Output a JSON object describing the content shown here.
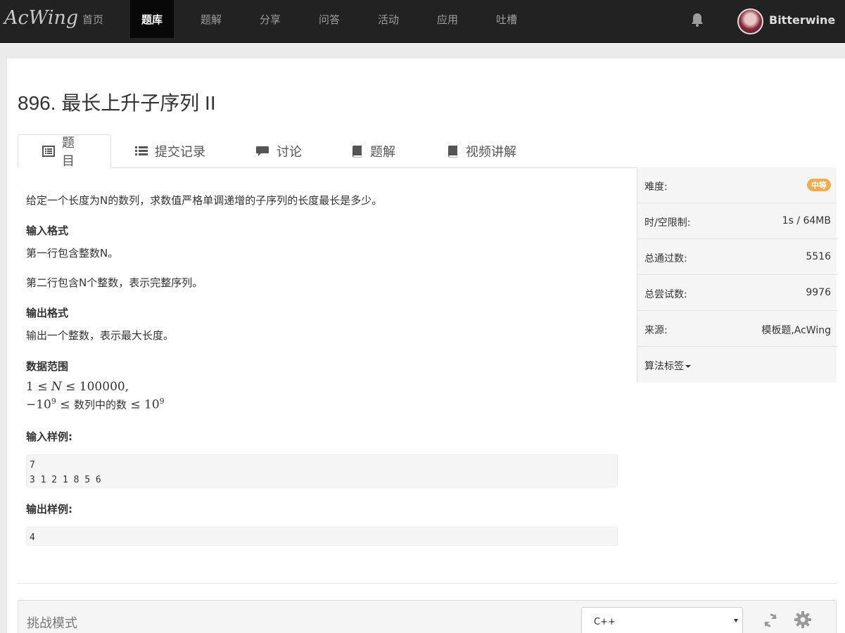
{
  "navbar": {
    "logo": "AcWing",
    "items": [
      "首页",
      "题库",
      "题解",
      "分享",
      "问答",
      "活动",
      "应用",
      "吐槽"
    ],
    "active_index": 1,
    "username": "Bitterwine"
  },
  "problem": {
    "title": "896. 最长上升子序列 II"
  },
  "tabs": [
    {
      "label": "题目",
      "icon": "list-alt-icon"
    },
    {
      "label": "提交记录",
      "icon": "list-icon"
    },
    {
      "label": "讨论",
      "icon": "comment-icon"
    },
    {
      "label": "题解",
      "icon": "book-icon"
    },
    {
      "label": "视频讲解",
      "icon": "book-icon"
    }
  ],
  "content": {
    "description": "给定一个长度为N的数列，求数值严格单调递增的子序列的长度最长是多少。",
    "input_heading": "输入格式",
    "input_line1": "第一行包含整数N。",
    "input_line2": "第二行包含N个整数，表示完整序列。",
    "output_heading": "输出格式",
    "output_text": "输出一个整数，表示最大长度。",
    "range_heading": "数据范围",
    "range_math1": {
      "a": "1 ≤ ",
      "var": "N",
      "b": " ≤ 100000,"
    },
    "range_math2": {
      "a": "−10",
      "exp1": "9",
      "b": " ≤ ",
      "text": "数列中的数",
      "c": " ≤ 10",
      "exp2": "9"
    },
    "sample_in_heading": "输入样例:",
    "sample_in": "7\n3 1 2 1 8 5 6",
    "sample_out_heading": "输出样例:",
    "sample_out": "4"
  },
  "sidebar": {
    "difficulty_label": "难度:",
    "difficulty_value": "中等",
    "difficulty_color": "#f0ad4e",
    "limit_label": "时/空限制:",
    "limit_value": "1s / 64MB",
    "passed_label": "总通过数:",
    "passed_value": "5516",
    "tried_label": "总尝试数:",
    "tried_value": "9976",
    "source_label": "来源:",
    "source_value": "模板题,AcWing",
    "tags_label": "算法标签"
  },
  "editor": {
    "mode_label": "挑战模式",
    "language": "C++"
  }
}
